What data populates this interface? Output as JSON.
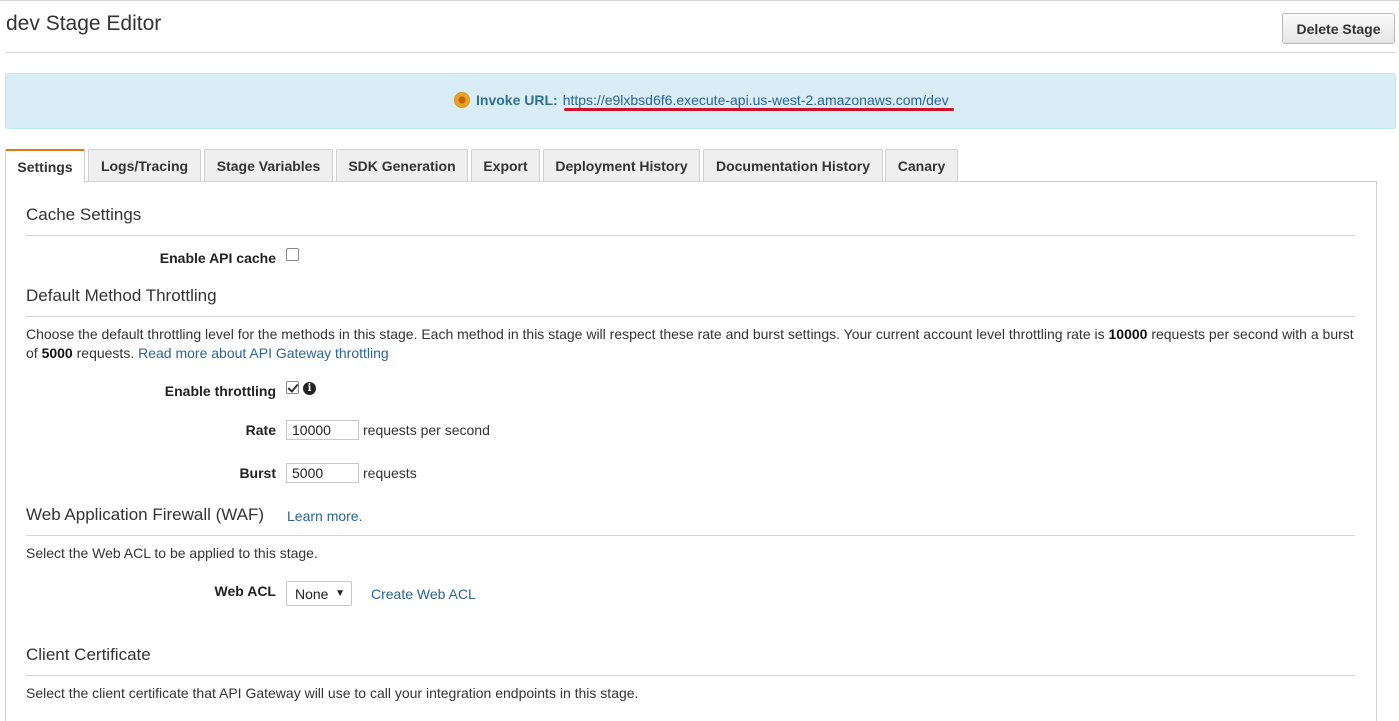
{
  "page": {
    "title": "dev Stage Editor",
    "delete_button": "Delete Stage"
  },
  "invoke": {
    "label": "Invoke URL:",
    "url": "https://e9lxbsd6f6.execute-api.us-west-2.amazonaws.com/dev",
    "icon": "status-dot-icon",
    "highlight_color": "#d0102a"
  },
  "tabs": [
    {
      "label": "Settings",
      "active": true
    },
    {
      "label": "Logs/Tracing"
    },
    {
      "label": "Stage Variables"
    },
    {
      "label": "SDK Generation"
    },
    {
      "label": "Export"
    },
    {
      "label": "Deployment History"
    },
    {
      "label": "Documentation History"
    },
    {
      "label": "Canary"
    }
  ],
  "cache": {
    "title": "Cache Settings",
    "enable_label": "Enable API cache",
    "enabled": false
  },
  "throttling": {
    "title": "Default Method Throttling",
    "description_part1": "Choose the default throttling level for the methods in this stage. Each method in this stage will respect these rate and burst settings. Your current account level throttling rate is ",
    "account_rate": "10000",
    "description_part2": " requests per second with a burst of ",
    "account_burst": "5000",
    "description_part3": " requests. ",
    "read_more_link": "Read more about API Gateway throttling",
    "enable_label": "Enable throttling",
    "enabled": true,
    "rate_label": "Rate",
    "rate_value": "10000",
    "rate_unit": "requests per second",
    "burst_label": "Burst",
    "burst_value": "5000",
    "burst_unit": "requests"
  },
  "waf": {
    "title": "Web Application Firewall (WAF)",
    "learn_more": "Learn more.",
    "description": "Select the Web ACL to be applied to this stage.",
    "acl_label": "Web ACL",
    "acl_selected": "None",
    "create_link": "Create Web ACL"
  },
  "client_cert": {
    "title": "Client Certificate",
    "description": "Select the client certificate that API Gateway will use to call your integration endpoints in this stage."
  },
  "colors": {
    "accent_tab": "#e47911",
    "info_bg": "#d9edf7",
    "link": "#2a6496"
  }
}
